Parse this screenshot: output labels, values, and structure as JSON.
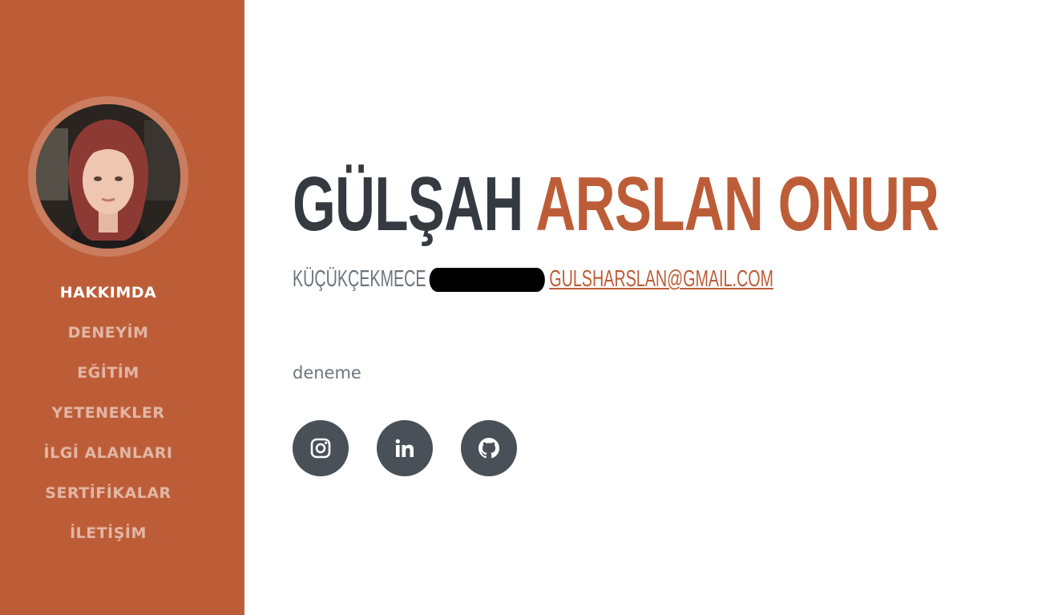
{
  "profile": {
    "first_name": "GÜLŞAH",
    "last_name": "ARSLAN ONUR",
    "location": "KÜÇÜKÇEKMECE",
    "email": "GULSHARSLAN@GMAIL.COM",
    "about": "deneme"
  },
  "nav": {
    "items": [
      {
        "label": "HAKKIMDA",
        "active": true
      },
      {
        "label": "DENEYİM"
      },
      {
        "label": "EĞİTİM"
      },
      {
        "label": "YETENEKLER"
      },
      {
        "label": "İLGİ ALANLARI"
      },
      {
        "label": "SERTİFİKALAR"
      },
      {
        "label": "İLETİŞİM"
      }
    ]
  },
  "social": [
    "instagram-icon",
    "linkedin-icon",
    "github-icon"
  ],
  "colors": {
    "primary": "#bd5d38",
    "dark": "#343a40",
    "muted": "#6c757d",
    "social_bg": "#495057"
  }
}
